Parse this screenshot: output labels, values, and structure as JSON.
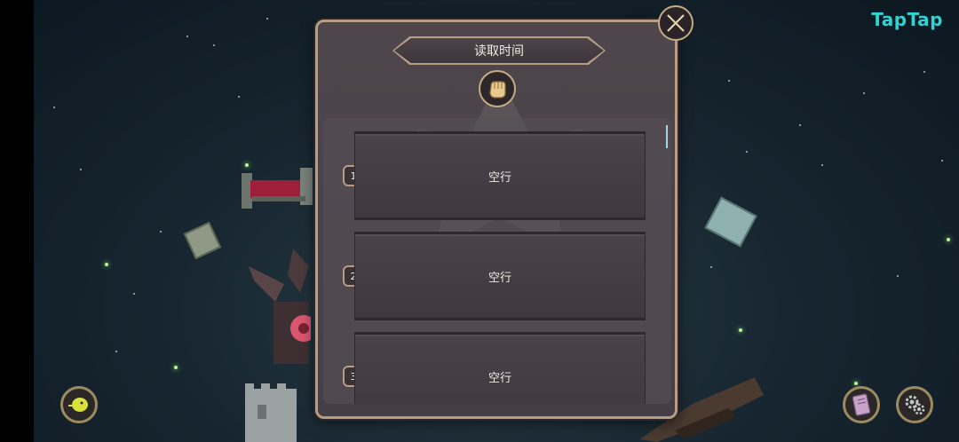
{
  "brand": {
    "name": "TapTap"
  },
  "dialog": {
    "title": "读取时间",
    "close_icon": "close-x-icon",
    "badge_icon": "grabbing-hand-icon",
    "slots": [
      {
        "number": "1",
        "label": "空行"
      },
      {
        "number": "2",
        "label": "空行"
      },
      {
        "number": "3",
        "label": "空行"
      }
    ]
  },
  "hud": {
    "left_button_icon": "yellow-creature-icon",
    "journal_button_icon": "notebook-icon",
    "settings_button_icon": "gears-icon"
  },
  "colors": {
    "accent_gold": "#b59e84",
    "panel": "#4a4249",
    "brand": "#2fd3d1"
  }
}
